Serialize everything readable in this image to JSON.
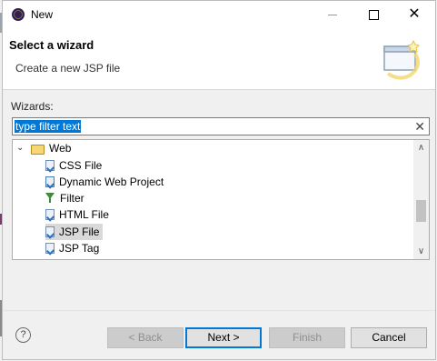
{
  "window": {
    "title": "New"
  },
  "header": {
    "title": "Select a wizard",
    "description": "Create a new JSP file"
  },
  "wizards_label": "Wizards:",
  "filter": {
    "value": "type filter text"
  },
  "tree": {
    "folder": "Web",
    "items": [
      {
        "label": "CSS File",
        "icon": "css-file-icon"
      },
      {
        "label": "Dynamic Web Project",
        "icon": "web-project-icon"
      },
      {
        "label": "Filter",
        "icon": "filter-icon"
      },
      {
        "label": "HTML File",
        "icon": "html-file-icon"
      },
      {
        "label": "JSP File",
        "icon": "jsp-file-icon",
        "selected": true
      },
      {
        "label": "JSP Tag",
        "icon": "jsp-tag-icon"
      }
    ]
  },
  "buttons": {
    "help": "?",
    "back": "< Back",
    "next": "Next >",
    "finish": "Finish",
    "cancel": "Cancel"
  },
  "colors": {
    "selection": "#0078d7",
    "tree_selected": "#d9d9d9"
  }
}
